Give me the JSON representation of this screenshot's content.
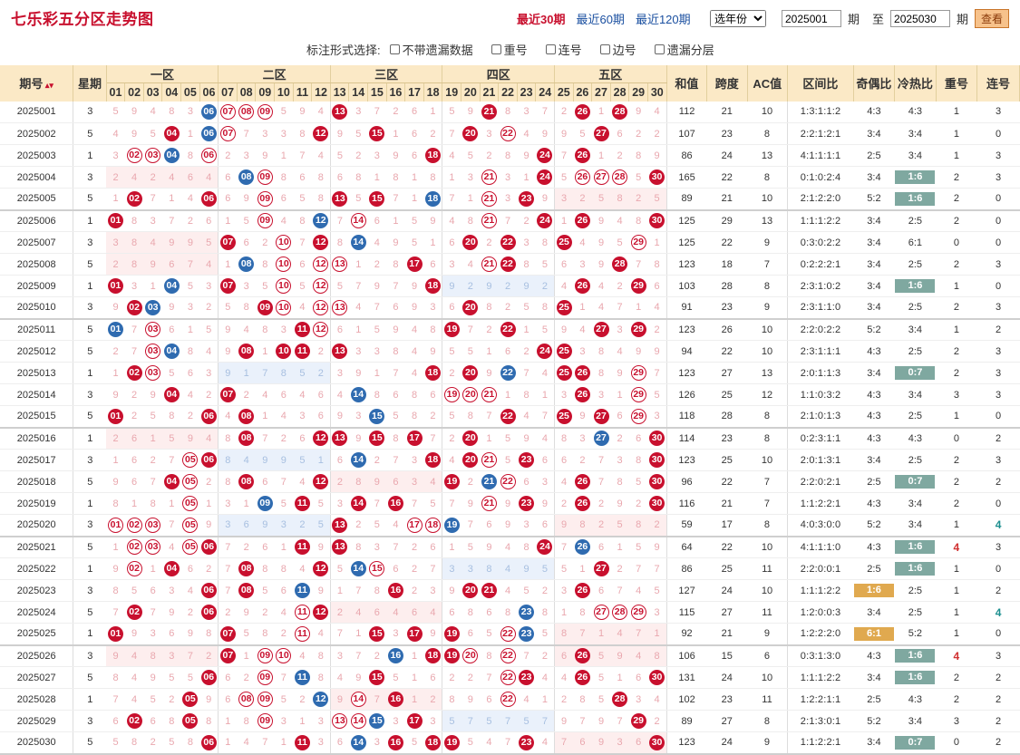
{
  "page": {
    "title": "七乐彩五分区走势图"
  },
  "nav": {
    "recent30": "最近30期",
    "recent60": "最近60期",
    "recent120": "最近120期"
  },
  "controls": {
    "year_select": "选年份",
    "from_value": "2025001",
    "from_unit": "期",
    "to_label": "至",
    "to_value": "2025030",
    "to_unit": "期",
    "query": "查看"
  },
  "options": {
    "label": "标注形式选择:",
    "items": [
      "不带遗漏数据",
      "重号",
      "连号",
      "边号",
      "遗漏分层"
    ]
  },
  "headers": {
    "issue": "期号",
    "week": "星期",
    "zones": [
      "一区",
      "二区",
      "三区",
      "四区",
      "五区"
    ],
    "sum": "和值",
    "span": "跨度",
    "ac": "AC值",
    "zone_ratio": "区间比",
    "odd_even": "奇偶比",
    "hot_cold": "冷热比",
    "repeat": "重号",
    "consecutive": "连号"
  },
  "numbers": [
    "01",
    "02",
    "03",
    "04",
    "05",
    "06",
    "07",
    "08",
    "09",
    "10",
    "11",
    "12",
    "13",
    "14",
    "15",
    "16",
    "17",
    "18",
    "19",
    "20",
    "21",
    "22",
    "23",
    "24",
    "25",
    "26",
    "27",
    "28",
    "29",
    "30"
  ],
  "rows": [
    {
      "issue": "2025001",
      "week": "3",
      "red": [
        6,
        7,
        8,
        9,
        13,
        21,
        26,
        28
      ],
      "blue": [
        6
      ],
      "ring": [
        7,
        8,
        9
      ],
      "sum": "112",
      "span": "21",
      "ac": "10",
      "ratio": "1:3:1:1:2",
      "oe": "4:3",
      "hc": "4:3",
      "rep": "1",
      "con": "3"
    },
    {
      "issue": "2025002",
      "week": "5",
      "red": [
        4,
        7,
        12,
        15,
        20,
        22,
        27
      ],
      "blue": [
        6
      ],
      "ring": [
        7,
        22
      ],
      "sum": "107",
      "span": "23",
      "ac": "8",
      "ratio": "2:2:1:2:1",
      "oe": "3:4",
      "hc": "3:4",
      "rep": "1",
      "con": "0"
    },
    {
      "issue": "2025003",
      "week": "1",
      "red": [
        2,
        3,
        6,
        18,
        24,
        26
      ],
      "blue": [
        4
      ],
      "ring": [
        2,
        3,
        6
      ],
      "sum": "86",
      "span": "24",
      "ac": "13",
      "ratio": "4:1:1:1:1",
      "oe": "2:5",
      "hc": "3:4",
      "rep": "1",
      "con": "3"
    },
    {
      "issue": "2025004",
      "week": "3",
      "red": [
        9,
        21,
        24,
        26,
        27,
        28,
        30
      ],
      "blue": [
        8
      ],
      "ring": [
        9,
        21,
        26,
        27,
        28
      ],
      "sum": "165",
      "span": "22",
      "ac": "8",
      "ratio": "0:1:0:2:4",
      "oe": "3:4",
      "hc": "1:6",
      "hcTag": "g",
      "rep": "2",
      "con": "3"
    },
    {
      "issue": "2025005",
      "week": "5",
      "red": [
        2,
        6,
        9,
        13,
        15,
        23
      ],
      "blue": [
        18
      ],
      "ring": [
        9,
        21
      ],
      "sum": "89",
      "span": "21",
      "ac": "10",
      "ratio": "2:1:2:2:0",
      "oe": "5:2",
      "hc": "1:6",
      "hcTag": "g",
      "rep": "2",
      "con": "0"
    },
    {
      "issue": "2025006",
      "week": "1",
      "red": [
        1,
        9,
        14,
        21,
        24,
        26,
        30
      ],
      "blue": [
        12
      ],
      "ring": [
        9,
        14,
        21
      ],
      "sum": "125",
      "span": "29",
      "ac": "13",
      "ratio": "1:1:1:2:2",
      "oe": "3:4",
      "hc": "2:5",
      "rep": "2",
      "con": "0"
    },
    {
      "issue": "2025007",
      "week": "3",
      "red": [
        7,
        10,
        12,
        20,
        22,
        25,
        29
      ],
      "blue": [
        14
      ],
      "ring": [
        10,
        29
      ],
      "sum": "125",
      "span": "22",
      "ac": "9",
      "ratio": "0:3:0:2:2",
      "oe": "3:4",
      "hc": "6:1",
      "rep": "0",
      "con": "0"
    },
    {
      "issue": "2025008",
      "week": "5",
      "red": [
        10,
        12,
        13,
        17,
        21,
        22,
        28
      ],
      "blue": [
        8
      ],
      "ring": [
        10,
        12,
        13,
        21
      ],
      "sum": "123",
      "span": "18",
      "ac": "7",
      "ratio": "0:2:2:2:1",
      "oe": "3:4",
      "hc": "2:5",
      "rep": "2",
      "con": "3"
    },
    {
      "issue": "2025009",
      "week": "1",
      "red": [
        1,
        7,
        10,
        12,
        18,
        26,
        29
      ],
      "blue": [
        4
      ],
      "ring": [
        10,
        12
      ],
      "sum": "103",
      "span": "28",
      "ac": "8",
      "ratio": "2:3:1:0:2",
      "oe": "3:4",
      "hc": "1:6",
      "hcTag": "g",
      "rep": "1",
      "con": "0"
    },
    {
      "issue": "2025010",
      "week": "3",
      "red": [
        2,
        9,
        10,
        12,
        13,
        20,
        25
      ],
      "blue": [
        3
      ],
      "ring": [
        10,
        12,
        13
      ],
      "sum": "91",
      "span": "23",
      "ac": "9",
      "ratio": "2:3:1:1:0",
      "oe": "3:4",
      "hc": "2:5",
      "rep": "2",
      "con": "3"
    },
    {
      "issue": "2025011",
      "week": "5",
      "red": [
        3,
        11,
        12,
        19,
        22,
        27,
        29
      ],
      "blue": [
        1
      ],
      "ring": [
        3,
        12
      ],
      "sum": "123",
      "span": "26",
      "ac": "10",
      "ratio": "2:2:0:2:2",
      "oe": "5:2",
      "hc": "3:4",
      "rep": "1",
      "con": "2"
    },
    {
      "issue": "2025012",
      "week": "5",
      "red": [
        3,
        8,
        10,
        11,
        13,
        24,
        25
      ],
      "blue": [
        4
      ],
      "ring": [
        3
      ],
      "sum": "94",
      "span": "22",
      "ac": "10",
      "ratio": "2:3:1:1:1",
      "oe": "4:3",
      "hc": "2:5",
      "rep": "2",
      "con": "3"
    },
    {
      "issue": "2025013",
      "week": "1",
      "red": [
        2,
        3,
        18,
        20,
        25,
        26,
        29
      ],
      "blue": [
        22
      ],
      "ring": [
        3,
        29
      ],
      "sum": "123",
      "span": "27",
      "ac": "13",
      "ratio": "2:0:1:1:3",
      "oe": "3:4",
      "hc": "0:7",
      "hcTag": "g",
      "rep": "2",
      "con": "3"
    },
    {
      "issue": "2025014",
      "week": "3",
      "red": [
        4,
        7,
        19,
        20,
        21,
        26,
        29
      ],
      "blue": [
        14
      ],
      "ring": [
        19,
        20,
        21,
        29
      ],
      "sum": "126",
      "span": "25",
      "ac": "12",
      "ratio": "1:1:0:3:2",
      "oe": "4:3",
      "hc": "3:4",
      "rep": "3",
      "con": "3"
    },
    {
      "issue": "2025015",
      "week": "5",
      "red": [
        1,
        6,
        8,
        22,
        25,
        27,
        29
      ],
      "blue": [
        15
      ],
      "ring": [
        29
      ],
      "sum": "118",
      "span": "28",
      "ac": "8",
      "ratio": "2:1:0:1:3",
      "oe": "4:3",
      "hc": "2:5",
      "rep": "1",
      "con": "0"
    },
    {
      "issue": "2025016",
      "week": "1",
      "red": [
        8,
        12,
        13,
        15,
        17,
        20,
        30
      ],
      "blue": [
        27
      ],
      "ring": [],
      "sum": "114",
      "span": "23",
      "ac": "8",
      "ratio": "0:2:3:1:1",
      "oe": "4:3",
      "hc": "4:3",
      "rep": "0",
      "con": "2"
    },
    {
      "issue": "2025017",
      "week": "3",
      "red": [
        6,
        18,
        20,
        21,
        23,
        30
      ],
      "blue": [
        14
      ],
      "ring": [
        5,
        21
      ],
      "sum": "123",
      "span": "25",
      "ac": "10",
      "ratio": "2:0:1:3:1",
      "oe": "3:4",
      "hc": "2:5",
      "rep": "2",
      "con": "3"
    },
    {
      "issue": "2025018",
      "week": "5",
      "red": [
        4,
        8,
        12,
        19,
        22,
        26,
        30
      ],
      "blue": [
        21
      ],
      "ring": [
        5,
        22
      ],
      "sum": "96",
      "span": "22",
      "ac": "7",
      "ratio": "2:2:0:2:1",
      "oe": "2:5",
      "hc": "0:7",
      "hcTag": "g",
      "rep": "2",
      "con": "2"
    },
    {
      "issue": "2025019",
      "week": "1",
      "red": [
        11,
        14,
        16,
        23,
        26,
        30
      ],
      "blue": [
        9
      ],
      "ring": [
        5,
        21
      ],
      "sum": "116",
      "span": "21",
      "ac": "7",
      "ratio": "1:1:2:2:1",
      "oe": "4:3",
      "hc": "3:4",
      "rep": "2",
      "con": "0"
    },
    {
      "issue": "2025020",
      "week": "3",
      "red": [
        13
      ],
      "blue": [
        19
      ],
      "ring": [
        1,
        2,
        3,
        5,
        17,
        18
      ],
      "sum": "59",
      "span": "17",
      "ac": "8",
      "ratio": "4:0:3:0:0",
      "oe": "5:2",
      "hc": "3:4",
      "rep": "1",
      "con": "4",
      "conColor": "teal"
    },
    {
      "issue": "2025021",
      "week": "5",
      "red": [
        6,
        11,
        13,
        24
      ],
      "blue": [
        26
      ],
      "ring": [
        2,
        3,
        5
      ],
      "sum": "64",
      "span": "22",
      "ac": "10",
      "ratio": "4:1:1:1:0",
      "oe": "4:3",
      "hc": "1:6",
      "hcTag": "g",
      "rep": "4",
      "repColor": "red",
      "con": "3"
    },
    {
      "issue": "2025022",
      "week": "1",
      "red": [
        4,
        8,
        12,
        27
      ],
      "blue": [
        14
      ],
      "ring": [
        2,
        15
      ],
      "sum": "86",
      "span": "25",
      "ac": "11",
      "ratio": "2:2:0:0:1",
      "oe": "2:5",
      "hc": "1:6",
      "hcTag": "g",
      "rep": "1",
      "con": "0"
    },
    {
      "issue": "2025023",
      "week": "3",
      "red": [
        6,
        8,
        16,
        20,
        21,
        26
      ],
      "blue": [
        11
      ],
      "ring": [],
      "sum": "127",
      "span": "24",
      "ac": "10",
      "ratio": "1:1:1:2:2",
      "oe": "1:6",
      "oeTag": "o",
      "hc": "2:5",
      "rep": "1",
      "con": "2"
    },
    {
      "issue": "2025024",
      "week": "5",
      "red": [
        2,
        6,
        12,
        29
      ],
      "blue": [
        23
      ],
      "ring": [
        11,
        27,
        28,
        29
      ],
      "sum": "115",
      "span": "27",
      "ac": "11",
      "ratio": "1:2:0:0:3",
      "oe": "3:4",
      "hc": "2:5",
      "rep": "1",
      "con": "4",
      "conColor": "teal"
    },
    {
      "issue": "2025025",
      "week": "1",
      "red": [
        1,
        7,
        15,
        17,
        19
      ],
      "blue": [
        23
      ],
      "ring": [
        11,
        22
      ],
      "sum": "92",
      "span": "21",
      "ac": "9",
      "ratio": "1:2:2:2:0",
      "oe": "6:1",
      "oeTag": "o",
      "hc": "5:2",
      "rep": "1",
      "con": "0"
    },
    {
      "issue": "2025026",
      "week": "3",
      "red": [
        7,
        18,
        19,
        22,
        26
      ],
      "blue": [
        16
      ],
      "ring": [
        9,
        10,
        20,
        22
      ],
      "sum": "106",
      "span": "15",
      "ac": "6",
      "ratio": "0:3:1:3:0",
      "oe": "4:3",
      "hc": "1:6",
      "hcTag": "g",
      "rep": "4",
      "repColor": "red",
      "con": "3"
    },
    {
      "issue": "2025027",
      "week": "5",
      "red": [
        6,
        15,
        23,
        26,
        30
      ],
      "blue": [
        11
      ],
      "ring": [
        9,
        22
      ],
      "sum": "131",
      "span": "24",
      "ac": "10",
      "ratio": "1:1:1:2:2",
      "oe": "3:4",
      "hc": "1:6",
      "hcTag": "g",
      "rep": "2",
      "con": "2"
    },
    {
      "issue": "2025028",
      "week": "1",
      "red": [
        5,
        16,
        28
      ],
      "blue": [
        12
      ],
      "ring": [
        8,
        9,
        14,
        22
      ],
      "sum": "102",
      "span": "23",
      "ac": "11",
      "ratio": "1:2:2:1:1",
      "oe": "2:5",
      "hc": "4:3",
      "rep": "2",
      "con": "2"
    },
    {
      "issue": "2025029",
      "week": "3",
      "red": [
        2,
        5,
        17,
        29
      ],
      "blue": [
        15
      ],
      "ring": [
        9,
        13,
        14
      ],
      "sum": "89",
      "span": "27",
      "ac": "8",
      "ratio": "2:1:3:0:1",
      "oe": "5:2",
      "hc": "3:4",
      "rep": "3",
      "con": "2"
    },
    {
      "issue": "2025030",
      "week": "5",
      "red": [
        6,
        11,
        16,
        18,
        19,
        23,
        30
      ],
      "blue": [
        14
      ],
      "ring": [],
      "sum": "123",
      "span": "24",
      "ac": "9",
      "ratio": "1:1:2:2:1",
      "oe": "3:4",
      "hc": "0:7",
      "hcTag": "g",
      "rep": "0",
      "con": "2"
    }
  ]
}
